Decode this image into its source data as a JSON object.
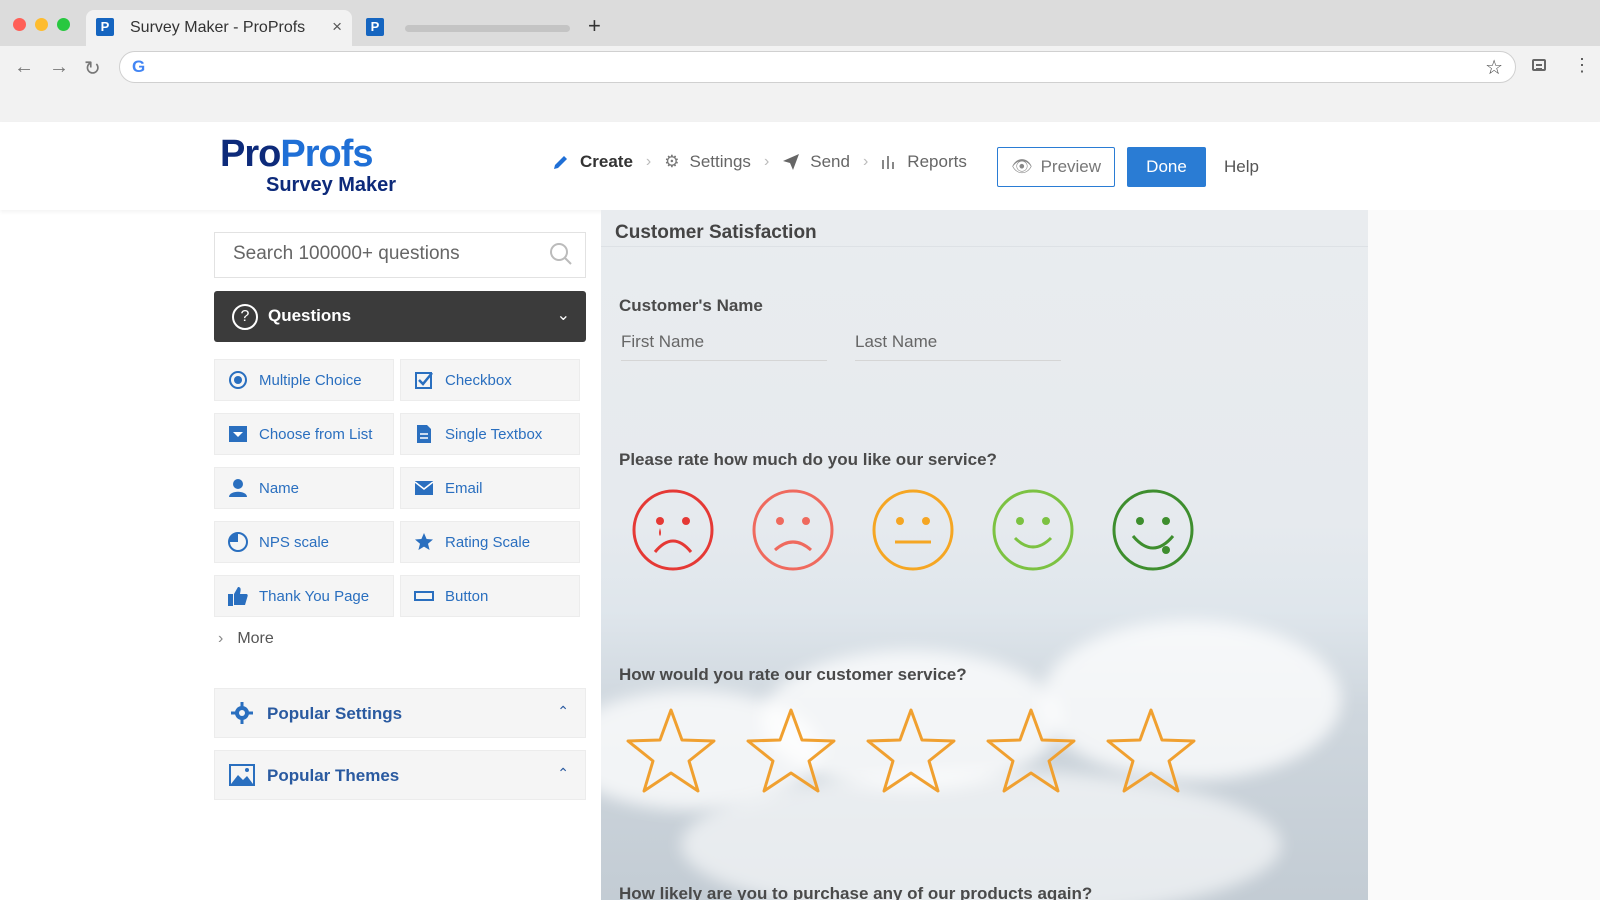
{
  "browser": {
    "tab_title": "Survey Maker - ProProfs",
    "tab_close": "×",
    "favicon": "P",
    "new_tab": "+",
    "back": "←",
    "forward": "→",
    "reload": "↻",
    "google_icon": "G",
    "bookmark_star": "☆",
    "menu": "⋮"
  },
  "header": {
    "logo_pro": "Pro",
    "logo_profs": "Profs",
    "logo_sub": "Survey Maker",
    "steps": [
      {
        "label": "Create",
        "icon": "pencil-icon"
      },
      {
        "label": "Settings",
        "icon": "gear-icon"
      },
      {
        "label": "Send",
        "icon": "paper-plane-icon"
      },
      {
        "label": "Reports",
        "icon": "bar-chart-icon"
      }
    ],
    "preview": "Preview",
    "done": "Done",
    "help": "Help"
  },
  "sidebar": {
    "search_placeholder": "Search 100000+ questions",
    "questions_label": "Questions",
    "question_types": [
      {
        "label": "Multiple Choice",
        "icon": "radio-icon"
      },
      {
        "label": "Checkbox",
        "icon": "checkbox-icon"
      },
      {
        "label": "Choose from List",
        "icon": "dropdown-icon"
      },
      {
        "label": "Single Textbox",
        "icon": "document-icon"
      },
      {
        "label": "Name",
        "icon": "person-icon"
      },
      {
        "label": "Email",
        "icon": "envelope-icon"
      },
      {
        "label": "NPS scale",
        "icon": "pie-icon"
      },
      {
        "label": "Rating Scale",
        "icon": "star-icon"
      },
      {
        "label": "Thank You Page",
        "icon": "thumbs-up-icon"
      },
      {
        "label": "Button",
        "icon": "button-icon"
      }
    ],
    "more": "More",
    "popular_settings": "Popular Settings",
    "popular_themes": "Popular Themes"
  },
  "survey": {
    "title": "Customer Satisfaction",
    "q1_label": "Customer's Name",
    "first_name": "First Name",
    "last_name": "Last Name",
    "q2_label": "Please rate how much do you like our service?",
    "smiley_colors": [
      "#e53935",
      "#ef6a5e",
      "#f5a623",
      "#7cc242",
      "#3e8e2e"
    ],
    "q3_label": "How would you rate our customer service?",
    "star_color": "#f0a030",
    "q4_label": "How likely are you to purchase any of our products again?"
  },
  "colors": {
    "accent": "#2a7cd4",
    "dark_header": "#3b3b3b"
  }
}
